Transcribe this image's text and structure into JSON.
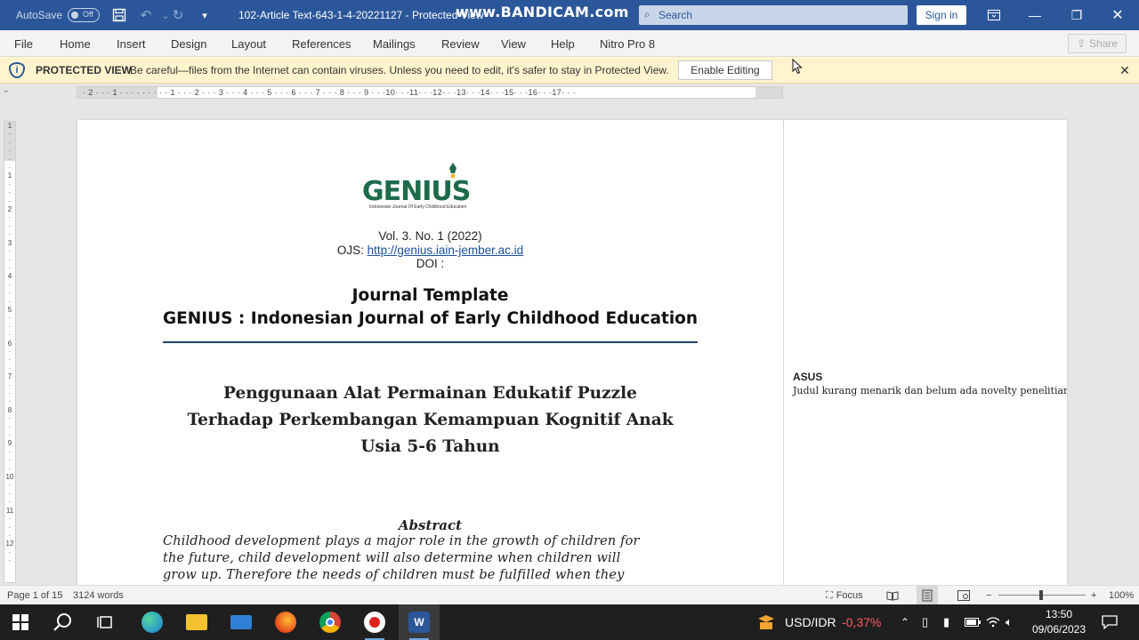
{
  "titlebar": {
    "autosave_label": "AutoSave",
    "autosave_state": "Off",
    "doc_title": "102-Article Text-643-1-4-20221127  -  Protected View",
    "watermark": "www.BANDICAM.com",
    "search_placeholder": "Search",
    "signin_label": "Sign in"
  },
  "menu": {
    "items": [
      "File",
      "Home",
      "Insert",
      "Design",
      "Layout",
      "References",
      "Mailings",
      "Review",
      "View",
      "Help",
      "Nitro Pro 8"
    ],
    "share_label": "Share"
  },
  "protected_view": {
    "title": "PROTECTED VIEW",
    "message": "Be careful—files from the Internet can contain viruses. Unless you need to edit, it's safer to stay in Protected View.",
    "button_label": "Enable Editing",
    "close_glyph": "✕"
  },
  "ruler": {
    "horizontal": "· 2 · · · 1 · · · · · · · · · 1 · · · 2 · · · 3 · · · 4 · · · 5 · · · 6 · · · 7 · · · 8 · · · 9 · · ·10· · ·11· · ·12· · ·13· · ·14· · ·15· · ·16· · ·17· · ·",
    "vertical": [
      "1",
      "·",
      "·",
      "·",
      "·",
      "·",
      "1",
      "·",
      "·",
      "·",
      "2",
      "·",
      "·",
      "·",
      "3",
      "·",
      "·",
      "·",
      "4",
      "·",
      "·",
      "·",
      "5",
      "·",
      "·",
      "·",
      "6",
      "·",
      "·",
      "·",
      "7",
      "·",
      "·",
      "·",
      "8",
      "·",
      "·",
      "·",
      "9",
      "·",
      "·",
      "·",
      "10",
      "·",
      "·",
      "·",
      "11",
      "·",
      "·",
      "·",
      "12",
      "·",
      "·"
    ]
  },
  "document": {
    "logo_word": "GENIUS",
    "logo_tagline": "Indonesian Journal Of Early Childhood Education",
    "volume": "Vol. 3. No. 1 (2022)",
    "ojs_label": "OJS: ",
    "ojs_url": "http://genius.iain-jember.ac.id",
    "doi": "DOI :",
    "journal_template": "Journal Template",
    "journal_name": "GENIUS : Indonesian Journal of Early Childhood Education",
    "article_title_lines": [
      "Penggunaan Alat Permainan Edukatif Puzzle",
      "Terhadap Perkembangan Kemampuan Kognitif Anak",
      "Usia 5-6 Tahun"
    ],
    "abstract_heading": "Abstract",
    "abstract_lines": [
      "Childhood development plays a major role in the growth of children for",
      "the future, child development will also determine when children will",
      "grow up. Therefore the needs of children must be fulfilled when they"
    ]
  },
  "comment": {
    "author": "ASUS",
    "text": "Judul kurang menarik dan belum ada novelty penelitian."
  },
  "statusbar": {
    "page": "Page 1 of 15",
    "words": "3124 words",
    "focus": "Focus",
    "zoom": "100%",
    "zoom_level_percent": 100
  },
  "taskbar": {
    "ticker_label": "USD/IDR",
    "ticker_change": "-0,37%",
    "time": "13:50",
    "date": "09/06/2023"
  },
  "colors": {
    "titlebar": "#2b579a",
    "protected_bg": "#fff4ce",
    "logo_green": "#1e6b4c",
    "ticker_red": "#ff5b5b"
  }
}
